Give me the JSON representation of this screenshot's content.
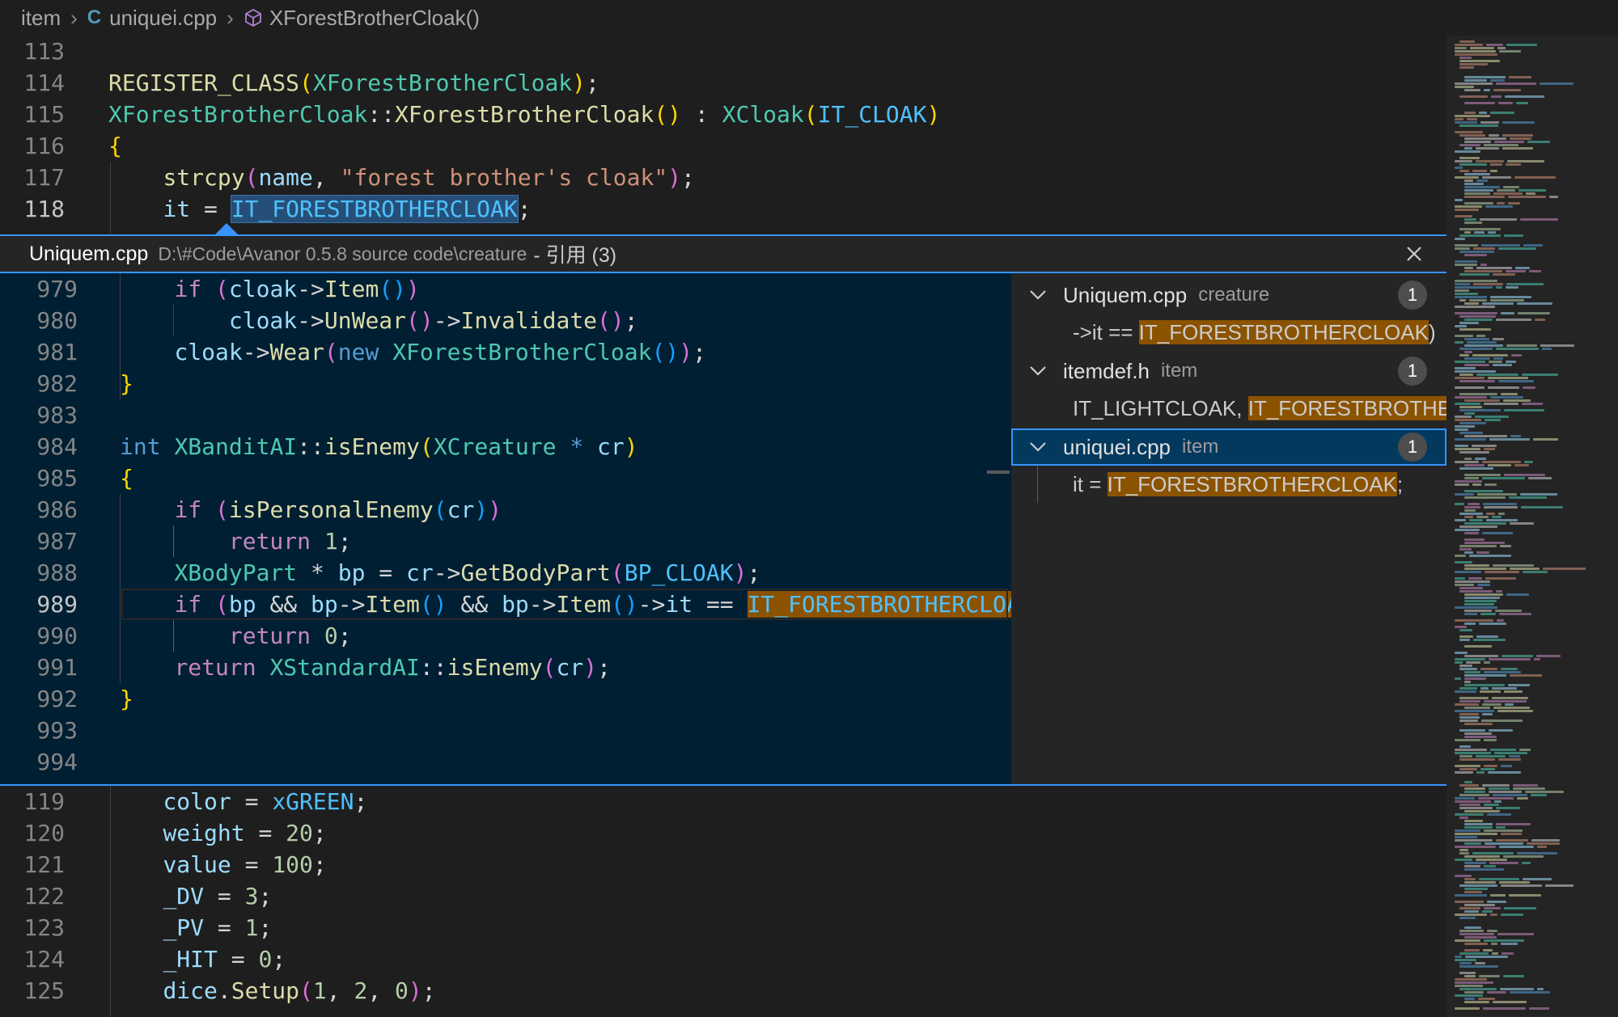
{
  "breadcrumb": {
    "folder": "item",
    "file": "uniquei.cpp",
    "symbol": "XForestBrotherCloak()"
  },
  "editor_top": [
    {
      "ln": "113",
      "tokens": []
    },
    {
      "ln": "114",
      "tokens": [
        [
          "fn",
          "REGISTER_CLASS"
        ],
        [
          "p1",
          "("
        ],
        [
          "ty",
          "XForestBrotherCloak"
        ],
        [
          "p1",
          ")"
        ],
        [
          "op",
          ";"
        ]
      ]
    },
    {
      "ln": "115",
      "tokens": [
        [
          "ty",
          "XForestBrotherCloak"
        ],
        [
          "op",
          "::"
        ],
        [
          "fn",
          "XForestBrotherCloak"
        ],
        [
          "p1",
          "()"
        ],
        [
          "op",
          " : "
        ],
        [
          "ty",
          "XCloak"
        ],
        [
          "p1",
          "("
        ],
        [
          "const",
          "IT_CLOAK"
        ],
        [
          "p1",
          ")"
        ]
      ]
    },
    {
      "ln": "116",
      "tokens": [
        [
          "p1",
          "{"
        ]
      ]
    },
    {
      "ln": "117",
      "tokens": [
        [
          "op",
          "    "
        ],
        [
          "fn",
          "strcpy"
        ],
        [
          "p2",
          "("
        ],
        [
          "var",
          "name"
        ],
        [
          "op",
          ", "
        ],
        [
          "str",
          "\"forest brother's cloak\""
        ],
        [
          "p2",
          ")"
        ],
        [
          "op",
          ";"
        ]
      ]
    },
    {
      "ln": "118",
      "active": true,
      "tokens": [
        [
          "op",
          "    "
        ],
        [
          "var",
          "it"
        ],
        [
          "op",
          " = "
        ],
        [
          "const hl-sel",
          "IT_FORESTBROTHERCLOAK"
        ],
        [
          "op",
          ";"
        ]
      ]
    }
  ],
  "peek": {
    "file": "Uniquem.cpp",
    "path": "D:\\#Code\\Avanor 0.5.8 source code\\creature",
    "suffix": "- 引用 (3)",
    "lines": [
      {
        "ln": "979",
        "tokens": [
          [
            "op",
            "    "
          ],
          [
            "ctl",
            "if"
          ],
          [
            "op",
            " "
          ],
          [
            "p2",
            "("
          ],
          [
            "var",
            "cloak"
          ],
          [
            "op",
            "->"
          ],
          [
            "fn",
            "Item"
          ],
          [
            "p3",
            "()"
          ],
          [
            "p2",
            ")"
          ]
        ]
      },
      {
        "ln": "980",
        "tokens": [
          [
            "op",
            "        "
          ],
          [
            "var",
            "cloak"
          ],
          [
            "op",
            "->"
          ],
          [
            "fn",
            "UnWear"
          ],
          [
            "p2",
            "()"
          ],
          [
            "op",
            "->"
          ],
          [
            "fn",
            "Invalidate"
          ],
          [
            "p2",
            "()"
          ],
          [
            "op",
            ";"
          ]
        ]
      },
      {
        "ln": "981",
        "tokens": [
          [
            "op",
            "    "
          ],
          [
            "var",
            "cloak"
          ],
          [
            "op",
            "->"
          ],
          [
            "fn",
            "Wear"
          ],
          [
            "p2",
            "("
          ],
          [
            "kw",
            "new"
          ],
          [
            "op",
            " "
          ],
          [
            "ty",
            "XForestBrotherCloak"
          ],
          [
            "p3",
            "()"
          ],
          [
            "p2",
            ")"
          ],
          [
            "op",
            ";"
          ]
        ]
      },
      {
        "ln": "982",
        "tokens": [
          [
            "p1",
            "}"
          ]
        ]
      },
      {
        "ln": "983",
        "tokens": []
      },
      {
        "ln": "984",
        "tokens": [
          [
            "kw",
            "int"
          ],
          [
            "op",
            " "
          ],
          [
            "ty",
            "XBanditAI"
          ],
          [
            "op",
            "::"
          ],
          [
            "fn",
            "isEnemy"
          ],
          [
            "p1",
            "("
          ],
          [
            "ty",
            "XCreature"
          ],
          [
            "op",
            " "
          ],
          [
            "kw",
            "*"
          ],
          [
            "op",
            " "
          ],
          [
            "var",
            "cr"
          ],
          [
            "p1",
            ")"
          ]
        ]
      },
      {
        "ln": "985",
        "tokens": [
          [
            "p1",
            "{"
          ]
        ]
      },
      {
        "ln": "986",
        "tokens": [
          [
            "op",
            "    "
          ],
          [
            "ctl",
            "if"
          ],
          [
            "op",
            " "
          ],
          [
            "p2",
            "("
          ],
          [
            "fn",
            "isPersonalEnemy"
          ],
          [
            "p3",
            "("
          ],
          [
            "var",
            "cr"
          ],
          [
            "p3",
            ")"
          ],
          [
            "p2",
            ")"
          ]
        ]
      },
      {
        "ln": "987",
        "tokens": [
          [
            "op",
            "        "
          ],
          [
            "ctl",
            "return"
          ],
          [
            "op",
            " "
          ],
          [
            "num",
            "1"
          ],
          [
            "op",
            ";"
          ]
        ]
      },
      {
        "ln": "988",
        "tokens": [
          [
            "op",
            "    "
          ],
          [
            "ty",
            "XBodyPart"
          ],
          [
            "op",
            " * "
          ],
          [
            "var",
            "bp"
          ],
          [
            "op",
            " = "
          ],
          [
            "var",
            "cr"
          ],
          [
            "op",
            "->"
          ],
          [
            "fn",
            "GetBodyPart"
          ],
          [
            "p2",
            "("
          ],
          [
            "const",
            "BP_CLOAK"
          ],
          [
            "p2",
            ")"
          ],
          [
            "op",
            ";"
          ]
        ]
      },
      {
        "ln": "989",
        "active": true,
        "tokens": [
          [
            "op",
            "    "
          ],
          [
            "ctl",
            "if"
          ],
          [
            "op",
            " "
          ],
          [
            "p2",
            "("
          ],
          [
            "var",
            "bp"
          ],
          [
            "op",
            " && "
          ],
          [
            "var",
            "bp"
          ],
          [
            "op",
            "->"
          ],
          [
            "fn",
            "Item"
          ],
          [
            "p3",
            "()"
          ],
          [
            "op",
            " && "
          ],
          [
            "var",
            "bp"
          ],
          [
            "op",
            "->"
          ],
          [
            "fn",
            "Item"
          ],
          [
            "p3",
            "()"
          ],
          [
            "op",
            "->"
          ],
          [
            "var",
            "it"
          ],
          [
            "op",
            " == "
          ],
          [
            "const hl-match",
            "IT_FORESTBROTHERCLOAK"
          ],
          [
            "p2",
            ")"
          ]
        ]
      },
      {
        "ln": "990",
        "tokens": [
          [
            "op",
            "        "
          ],
          [
            "ctl",
            "return"
          ],
          [
            "op",
            " "
          ],
          [
            "num",
            "0"
          ],
          [
            "op",
            ";"
          ]
        ]
      },
      {
        "ln": "991",
        "tokens": [
          [
            "op",
            "    "
          ],
          [
            "ctl",
            "return"
          ],
          [
            "op",
            " "
          ],
          [
            "ty",
            "XStandardAI"
          ],
          [
            "op",
            "::"
          ],
          [
            "fn",
            "isEnemy"
          ],
          [
            "p2",
            "("
          ],
          [
            "var",
            "cr"
          ],
          [
            "p2",
            ")"
          ],
          [
            "op",
            ";"
          ]
        ]
      },
      {
        "ln": "992",
        "tokens": [
          [
            "p1",
            "}"
          ]
        ]
      },
      {
        "ln": "993",
        "tokens": []
      },
      {
        "ln": "994",
        "tokens": []
      }
    ],
    "refs": [
      {
        "file": "Uniquem.cpp",
        "dir": "creature",
        "count": "1",
        "pre": "->it == ",
        "match": "IT_FORESTBROTHERCLOAK",
        "post": ")"
      },
      {
        "file": "itemdef.h",
        "dir": "item",
        "count": "1",
        "pre": "IT_LIGHTCLOAK, ",
        "match": "IT_FORESTBROTHERCL",
        "post": ""
      },
      {
        "file": "uniquei.cpp",
        "dir": "item",
        "count": "1",
        "selected": true,
        "pre": "it = ",
        "match": "IT_FORESTBROTHERCLOAK",
        "post": ";"
      }
    ]
  },
  "editor_bottom": [
    {
      "ln": "119",
      "tokens": [
        [
          "op",
          "    "
        ],
        [
          "var",
          "color"
        ],
        [
          "op",
          " = "
        ],
        [
          "const",
          "xGREEN"
        ],
        [
          "op",
          ";"
        ]
      ]
    },
    {
      "ln": "120",
      "tokens": [
        [
          "op",
          "    "
        ],
        [
          "var",
          "weight"
        ],
        [
          "op",
          " = "
        ],
        [
          "num",
          "20"
        ],
        [
          "op",
          ";"
        ]
      ]
    },
    {
      "ln": "121",
      "tokens": [
        [
          "op",
          "    "
        ],
        [
          "var",
          "value"
        ],
        [
          "op",
          " = "
        ],
        [
          "num",
          "100"
        ],
        [
          "op",
          ";"
        ]
      ]
    },
    {
      "ln": "122",
      "tokens": [
        [
          "op",
          "    "
        ],
        [
          "var",
          "_DV"
        ],
        [
          "op",
          " = "
        ],
        [
          "num",
          "3"
        ],
        [
          "op",
          ";"
        ]
      ]
    },
    {
      "ln": "123",
      "tokens": [
        [
          "op",
          "    "
        ],
        [
          "var",
          "_PV"
        ],
        [
          "op",
          " = "
        ],
        [
          "num",
          "1"
        ],
        [
          "op",
          ";"
        ]
      ]
    },
    {
      "ln": "124",
      "tokens": [
        [
          "op",
          "    "
        ],
        [
          "var",
          "_HIT"
        ],
        [
          "op",
          " = "
        ],
        [
          "num",
          "0"
        ],
        [
          "op",
          ";"
        ]
      ]
    },
    {
      "ln": "125",
      "tokens": [
        [
          "op",
          "    "
        ],
        [
          "var",
          "dice"
        ],
        [
          "op",
          "."
        ],
        [
          "fn",
          "Setup"
        ],
        [
          "p2",
          "("
        ],
        [
          "num",
          "1"
        ],
        [
          "op",
          ", "
        ],
        [
          "num",
          "2"
        ],
        [
          "op",
          ", "
        ],
        [
          "num",
          "0"
        ],
        [
          "p2",
          ")"
        ],
        [
          "op",
          ";"
        ]
      ]
    }
  ],
  "icons": {
    "file_icon": "cpp-file-icon",
    "symbol_icon": "method-cube-icon",
    "close": "close-icon",
    "chevron": "chevron-down-icon"
  },
  "colors": {
    "accent": "#3794ff",
    "peek_bg": "#001f33",
    "match_bg": "#8b5300"
  }
}
